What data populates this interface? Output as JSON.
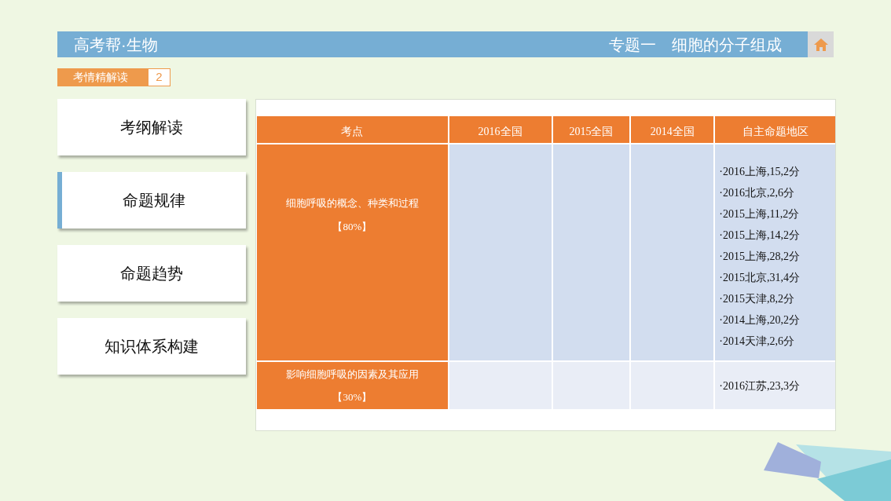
{
  "header": {
    "brand": "高考帮·生物",
    "topic": "专题一　细胞的分子组成"
  },
  "section_tag": {
    "label": "考情精解读",
    "number": "2"
  },
  "sidebar": {
    "items": [
      {
        "label": "考纲解读",
        "selected": false
      },
      {
        "label": "命题规律",
        "selected": true
      },
      {
        "label": "命题趋势",
        "selected": false
      },
      {
        "label": "知识体系构建",
        "selected": false
      }
    ]
  },
  "table": {
    "columns": [
      "考点",
      "2016全国",
      "2015全国",
      "2014全国",
      "自主命题地区"
    ],
    "rows": [
      {
        "topic": "细胞呼吸的概念、种类和过程",
        "weight": "【80%】",
        "col_2016": "",
        "col_2015": "",
        "col_2014": "",
        "regions": [
          "·2016上海,15,2分",
          "·2016北京,2,6分",
          "·2015上海,11,2分",
          "·2015上海,14,2分",
          "·2015上海,28,2分",
          "·2015北京,31,4分",
          "·2015天津,8,2分",
          "·2014上海,20,2分",
          "·2014天津,2,6分"
        ]
      },
      {
        "topic": "影响细胞呼吸的因素及其应用",
        "weight": "【30%】",
        "col_2016": "",
        "col_2015": "",
        "col_2014": "",
        "regions": [
          "·2016江苏,23,3分"
        ]
      }
    ]
  }
}
